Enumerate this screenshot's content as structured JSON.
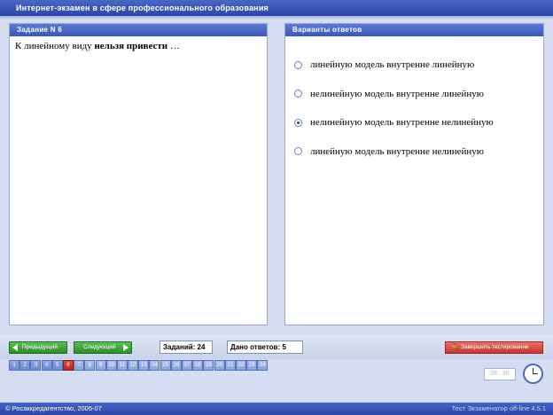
{
  "window": {
    "title": "Интернет-экзамен в сфере профессионального образования"
  },
  "question_panel": {
    "header": "Задание N 6",
    "text_prefix": "К линейному виду ",
    "text_bold": "нельзя привести",
    "text_suffix": " …"
  },
  "answers_panel": {
    "header": "Варианты ответов",
    "options": [
      {
        "label": "линейную модель внутренне линейную",
        "selected": false
      },
      {
        "label": "нелинейную модель внутренне линейную",
        "selected": false
      },
      {
        "label": "нелинейную модель внутренне нелинейную",
        "selected": true
      },
      {
        "label": "линейную модель внутренне нелинейную",
        "selected": false
      }
    ]
  },
  "toolbar": {
    "prev_label": "Предыдущий",
    "next_label": "Следующий",
    "tasks_count": "Заданий: 24",
    "answers_given": "Дано ответов: 5",
    "finish_label": "Завершить тестирование"
  },
  "tasks": {
    "numbers": [
      "1",
      "2",
      "3",
      "4",
      "5",
      "6",
      "7",
      "8",
      "9",
      "10",
      "11",
      "12",
      "13",
      "14",
      "15",
      "16",
      "17",
      "18",
      "19",
      "20",
      "21",
      "22",
      "23",
      "24"
    ],
    "current": "6",
    "answered": [
      "1",
      "2",
      "3",
      "4",
      "5"
    ]
  },
  "timer": {
    "value": "28 : 30"
  },
  "status": {
    "left": "© Росаккредагентство, 2005-07",
    "right": "Тест Экзаменатор off-line 4.5.1"
  },
  "colors": {
    "accent": "#3a57b6",
    "nav_green": "#2b8d2b",
    "finish_red": "#c5352c",
    "current_task": "#b72a21"
  }
}
